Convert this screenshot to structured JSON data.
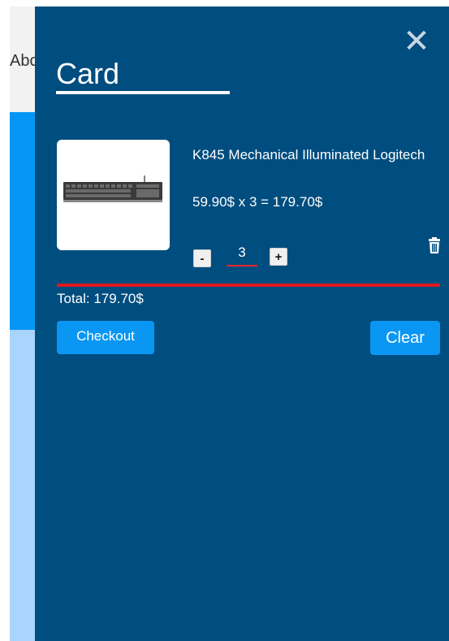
{
  "background": {
    "nav_text": "About"
  },
  "cart": {
    "title": "Card",
    "close_symbol": "✕",
    "item": {
      "name": "K845 Mechanical Illuminated Logitech",
      "price_line": "59.90$ x 3 = 179.70$",
      "quantity": "3",
      "minus_label": "-",
      "plus_label": "+",
      "image_icon": "keyboard-icon",
      "delete_icon": "trash-icon"
    },
    "total": "Total: 179.70$",
    "checkout_label": "Checkout",
    "clear_label": "Clear"
  },
  "colors": {
    "drawer_bg": "#004d7f",
    "accent_blue": "#0a96f3",
    "divider_red": "#e0181e"
  }
}
